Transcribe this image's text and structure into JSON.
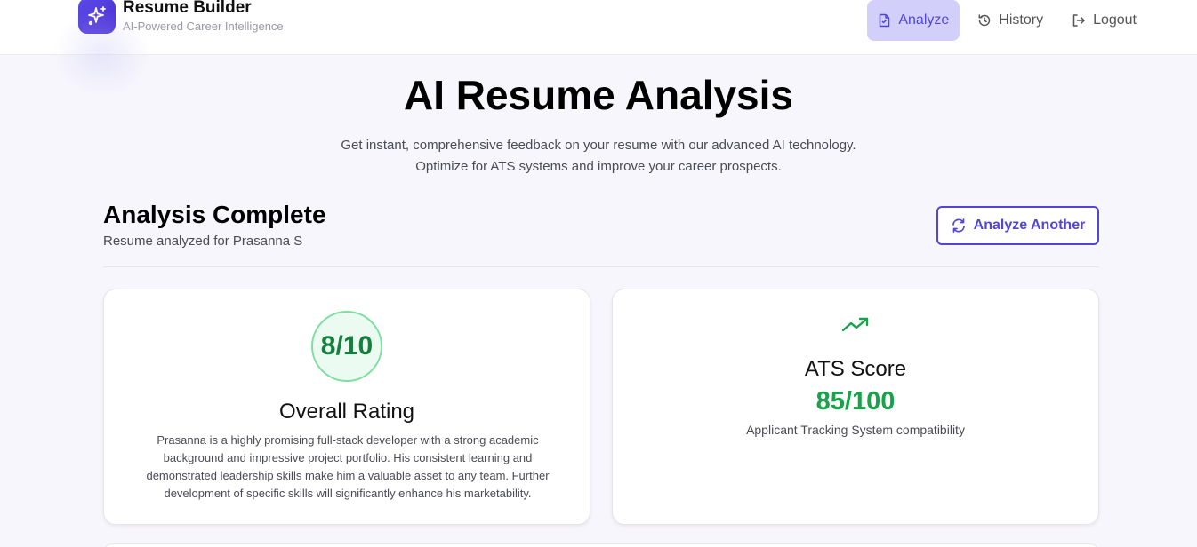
{
  "brand": {
    "title": "Resume Builder",
    "subtitle": "AI-Powered Career Intelligence"
  },
  "nav": {
    "items": [
      {
        "label": "Analyze",
        "icon": "document-icon",
        "active": true
      },
      {
        "label": "History",
        "icon": "history-icon",
        "active": false
      },
      {
        "label": "Logout",
        "icon": "logout-icon",
        "active": false
      }
    ]
  },
  "hero": {
    "title": "AI Resume Analysis",
    "desc_line1": "Get instant, comprehensive feedback on your resume with our advanced AI technology.",
    "desc_line2": "Optimize for ATS systems and improve your career prospects."
  },
  "analysis": {
    "title": "Analysis Complete",
    "subtitle": "Resume analyzed for Prasanna S",
    "analyze_another_label": "Analyze Another"
  },
  "overall": {
    "score": "8/10",
    "heading": "Overall Rating",
    "summary": "Prasanna is a highly promising full-stack developer with a strong academic background and impressive project portfolio. His consistent learning and demonstrated leadership skills make him a valuable asset to any team. Further development of specific skills will significantly enhance his marketability."
  },
  "ats": {
    "heading": "ATS Score",
    "score": "85/100",
    "caption": "Applicant Tracking System compatibility",
    "icon": "trending-up-icon"
  },
  "colors": {
    "accent": "#5145d6",
    "nav_active_bg": "#d2cffa",
    "success": "#16a34a",
    "rating_text": "#15803d",
    "background": "#f7f6fc"
  }
}
